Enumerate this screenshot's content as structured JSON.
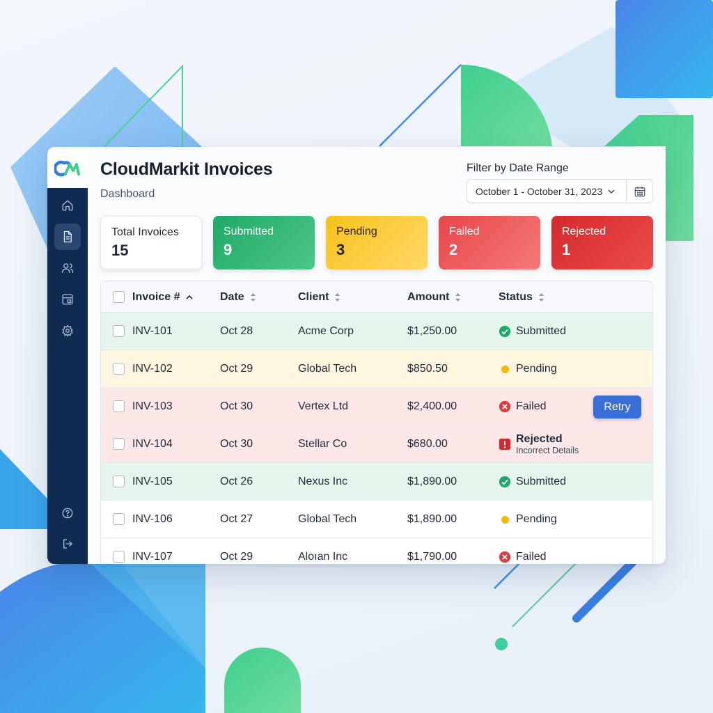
{
  "app": {
    "title": "CloudMarkit Invoices",
    "subtitle": "Dashboard",
    "logo_icon": "cloudmarkit-logo-icon"
  },
  "sidebar": {
    "items": [
      {
        "icon": "home-icon",
        "active": false
      },
      {
        "icon": "document-icon",
        "active": true
      },
      {
        "icon": "users-icon",
        "active": false
      },
      {
        "icon": "billing-icon",
        "active": false
      },
      {
        "icon": "gear-icon",
        "active": false
      }
    ],
    "bottom_items": [
      {
        "icon": "help-icon"
      },
      {
        "icon": "logout-icon"
      }
    ]
  },
  "filter": {
    "label": "Filter by Date Range",
    "value": "October 1 - October 31, 2023",
    "chevron_icon": "chevron-down-icon",
    "calendar_icon": "calendar-icon"
  },
  "summary": {
    "total": {
      "label": "Total Invoices",
      "value": "15"
    },
    "submitted": {
      "label": "Submitted",
      "value": "9",
      "color": "#1fa968"
    },
    "pending": {
      "label": "Pending",
      "value": "3",
      "color": "#f8c21c"
    },
    "failed": {
      "label": "Failed",
      "value": "2",
      "color": "#e8464a"
    },
    "rejected": {
      "label": "Rejected",
      "value": "1",
      "color": "#d32a2d"
    }
  },
  "table": {
    "headers": {
      "invoice": "Invoice #",
      "date": "Date",
      "client": "Client",
      "amount": "Amount",
      "status": "Status"
    },
    "rows": [
      {
        "invoice": "INV-101",
        "date": "Oct 28",
        "client": "Acme Corp",
        "amount": "$1,250.00",
        "status": "Submitted"
      },
      {
        "invoice": "INV-102",
        "date": "Oct 29",
        "client": "Global Tech",
        "amount": "$850.50",
        "status": "Pending"
      },
      {
        "invoice": "INV-103",
        "date": "Oct 30",
        "client": "Vertex Ltd",
        "amount": "$2,400.00",
        "status": "Failed",
        "action": "Retry"
      },
      {
        "invoice": "INV-104",
        "date": "Oct 30",
        "client": "Stellar Co",
        "amount": "$680.00",
        "status": "Rejected",
        "status_detail": "Incorrect Details"
      },
      {
        "invoice": "INV-105",
        "date": "Oct 26",
        "client": "Nexus Inc",
        "amount": "$1,890.00",
        "status": "Submitted"
      },
      {
        "invoice": "INV-106",
        "date": "Oct 27",
        "client": "Global Tech",
        "amount": "$1,890.00",
        "status": "Pending"
      },
      {
        "invoice": "INV-107",
        "date": "Oct 29",
        "client": "Aloıan Inc",
        "amount": "$1,790.00",
        "status": "Failed"
      }
    ]
  },
  "colors": {
    "sidebar": "#0f2b52",
    "accent_blue": "#3a6fd8",
    "submitted": "#1fa968",
    "pending": "#f5b800",
    "failed": "#e03a3e"
  }
}
